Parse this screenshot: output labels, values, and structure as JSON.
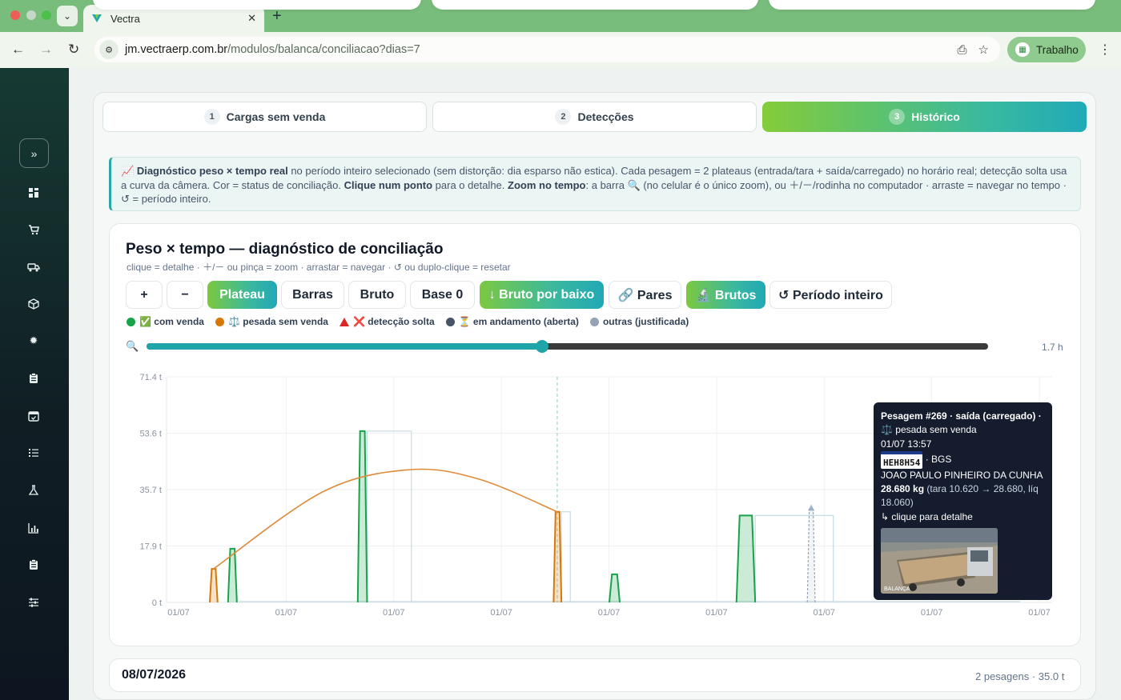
{
  "browser": {
    "tab_title": "Vectra",
    "url_host": "jm.vectraerp.com.br",
    "url_path": "/modulos/balanca/conciliacao?dias=7",
    "profile_label": "Trabalho"
  },
  "sidebar": {
    "icons": [
      "dashboard-icon",
      "cart-icon",
      "truck-icon",
      "box-icon",
      "gear-icon",
      "clipboard-icon",
      "calendar-icon",
      "list-icon",
      "flask-icon",
      "bar-chart-icon",
      "clipboard-check-icon",
      "sliders-icon"
    ]
  },
  "steps": [
    {
      "num": "1",
      "label": "Cargas sem venda",
      "active": false
    },
    {
      "num": "2",
      "label": "Detecções",
      "active": false
    },
    {
      "num": "3",
      "label": "Histórico",
      "active": true
    }
  ],
  "info": {
    "icon": "📈",
    "b1": "Diagnóstico peso × tempo real",
    "t1": " no período inteiro selecionado (sem distorção: dia esparso não estica). Cada pesagem = 2 plateaus (entrada/tara + saída/carregado) no horário real; detecção solta usa a curva da câmera. Cor = status de conciliação. ",
    "b2": "Clique num ponto",
    "t2": " para o detalhe. ",
    "b3": "Zoom no tempo",
    "t3": ": a barra 🔍 (no celular é o único zoom), ou ＋/－/rodinha no computador · arraste = navegar no tempo · ↺ = período inteiro."
  },
  "chart_header": {
    "title": "Peso × tempo — diagnóstico de conciliação",
    "subtitle": "clique = detalhe · ＋/－ ou pinça = zoom · arrastar = navegar · ↺ ou duplo-clique = resetar"
  },
  "controls": {
    "zoom_in": "+",
    "zoom_out": "−",
    "plateau": "Plateau",
    "barras": "Barras",
    "bruto": "Bruto",
    "base0": "Base 0",
    "bruto_por_baixo": "↓ Bruto por baixo",
    "pares": "🔗 Pares",
    "brutos": "🔬 Brutos",
    "periodo": "↺ Período inteiro"
  },
  "legend": [
    {
      "label": "✅ com venda",
      "color": "#16a34a",
      "shape": "dot"
    },
    {
      "label": "⚖️ pesada sem venda",
      "color": "#d97706",
      "shape": "dot"
    },
    {
      "label": "❌ detecção solta",
      "color": "#dc2626",
      "shape": "triangle"
    },
    {
      "label": "⏳ em andamento (aberta)",
      "color": "#475569",
      "shape": "dot"
    },
    {
      "label": "outras (justificada)",
      "color": "#94a3b8",
      "shape": "dot"
    }
  ],
  "zoom": {
    "level": 0.47,
    "readout": "1.7 h"
  },
  "chart_data": {
    "type": "area",
    "y_unit": "t",
    "ylim": [
      0,
      71.4
    ],
    "y_ticks": [
      "0 t",
      "17.9 t",
      "35.7 t",
      "53.6 t",
      "71.4 t"
    ],
    "x_ticks": [
      "01/07",
      "01/07",
      "01/07",
      "01/07",
      "01/07",
      "01/07",
      "01/07",
      "01/07",
      "01/07"
    ],
    "x_range_hours": [
      0,
      1.7
    ],
    "grid": true,
    "plateaus": [
      {
        "status": "pesada sem venda",
        "color": "#d97706",
        "x": [
          0.083,
          0.098
        ],
        "y": 10.6
      },
      {
        "status": "com venda",
        "color": "#16a34a",
        "x": [
          0.118,
          0.135
        ],
        "y": 17.0
      },
      {
        "status": "com venda",
        "color": "#16a34a",
        "x": [
          0.367,
          0.385
        ],
        "y": 54.2
      },
      {
        "status": "pesada sem venda",
        "color": "#d97706",
        "x": [
          0.743,
          0.758
        ],
        "y": 28.68
      },
      {
        "status": "com venda",
        "color": "#16a34a",
        "x": [
          0.85,
          0.87
        ],
        "y": 8.9
      },
      {
        "status": "com venda",
        "color": "#16a34a",
        "x": [
          1.094,
          1.13
        ],
        "y": 27.5
      },
      {
        "status": "outras (justificada)",
        "color": "#94a3b8",
        "x": [
          1.23,
          1.245
        ],
        "y": 29.5
      }
    ],
    "raw_outline": [
      {
        "x": [
          0.385,
          0.47
        ],
        "y": 54.2
      },
      {
        "x": [
          0.758,
          0.775
        ],
        "y": 28.68
      },
      {
        "x": [
          1.13,
          1.28
        ],
        "y": 27.5
      }
    ],
    "camera_curve": {
      "color": "#e08a3a",
      "x": [
        0.09,
        0.3,
        0.467,
        0.6,
        0.75
      ],
      "y": [
        10.6,
        35.0,
        42.0,
        39.0,
        28.7
      ]
    },
    "cursor_x": 0.75
  },
  "tooltip": {
    "title": "Pesagem #269 · saída (carregado) ·",
    "status": "⚖️ pesada sem venda",
    "datetime": "01/07 13:57",
    "plate": "HEH8H54",
    "company": "· BGS",
    "driver": "JOAO PAULO PINHEIRO DA CUNHA",
    "weight_bold": "28.680 kg",
    "weight_detail": " (tara 10.620 → 28.680, líq 18.060)",
    "hint": "↳ clique para detalhe",
    "photo_caption": "BALANÇA"
  },
  "day": {
    "date": "08/07/2026",
    "summary": "2 pesagens · 35.0 t"
  }
}
